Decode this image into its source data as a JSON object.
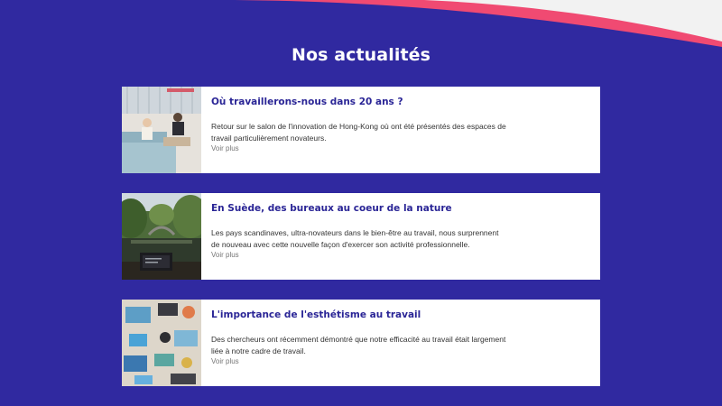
{
  "section": {
    "title": "Nos actualités"
  },
  "colors": {
    "background": "#3029a0",
    "accent": "#f04a72",
    "title_blue": "#2a2596"
  },
  "articles": [
    {
      "title": "Où travaillerons-nous dans 20 ans ?",
      "excerpt": "Retour sur le salon de l'innovation de Hong-Kong où ont été présentés des espaces de travail particulièrement novateurs.",
      "more": "Voir plus",
      "image": "office-lounge-photo"
    },
    {
      "title": "En Suède, des bureaux au coeur de la nature",
      "excerpt": "Les pays scandinaves, ultra-novateurs dans le bien-être au travail, nous surprennent de nouveau avec cette nouvelle façon d'exercer son activité professionnelle.",
      "more": "Voir plus",
      "image": "forest-river-laptop-photo"
    },
    {
      "title": "L'importance de l'esthétisme au travail",
      "excerpt": "Des chercheurs ont récemment démontré que notre efficacité au travail était largement liée à notre cadre de travail.",
      "more": "Voir plus",
      "image": "desk-top-view-photo"
    }
  ]
}
